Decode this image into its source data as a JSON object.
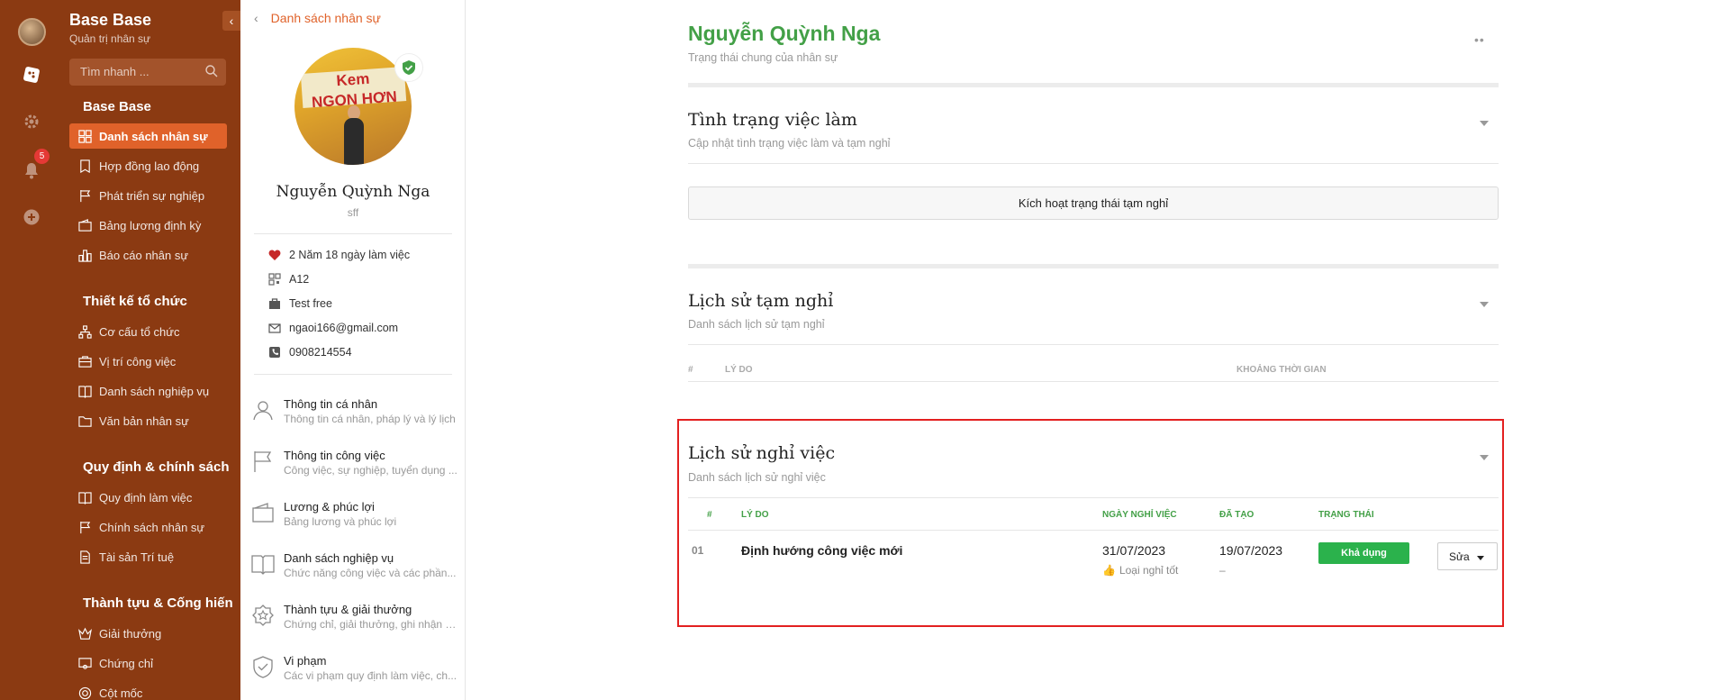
{
  "rail": {
    "notification_count": "5"
  },
  "sidebar": {
    "title": "Base Base",
    "subtitle": "Quản trị nhân sự",
    "search_placeholder": "Tìm nhanh ...",
    "groups": [
      {
        "label": "Base Base",
        "items": [
          {
            "label": "Danh sách nhân sự",
            "icon": "grid-icon",
            "active": true
          },
          {
            "label": "Hợp đồng lao động",
            "icon": "bookmark-icon"
          },
          {
            "label": "Phát triển sự nghiệp",
            "icon": "flag-icon"
          },
          {
            "label": "Bảng lương định kỳ",
            "icon": "wallet-icon"
          },
          {
            "label": "Báo cáo nhân sự",
            "icon": "bar-chart-icon"
          }
        ]
      },
      {
        "label": "Thiết kế tổ chức",
        "items": [
          {
            "label": "Cơ cấu tổ chức",
            "icon": "org-chart-icon"
          },
          {
            "label": "Vị trí công việc",
            "icon": "briefcase-icon"
          },
          {
            "label": "Danh sách nghiệp vụ",
            "icon": "book-icon"
          },
          {
            "label": "Văn bản nhân sự",
            "icon": "folder-icon"
          }
        ]
      },
      {
        "label": "Quy định & chính sách",
        "items": [
          {
            "label": "Quy định làm việc",
            "icon": "book-icon"
          },
          {
            "label": "Chính sách nhân sự",
            "icon": "flag-icon"
          },
          {
            "label": "Tài sản Trí tuệ",
            "icon": "document-icon"
          }
        ]
      },
      {
        "label": "Thành tựu & Cống hiến",
        "items": [
          {
            "label": "Giải thưởng",
            "icon": "crown-icon"
          },
          {
            "label": "Chứng chỉ",
            "icon": "certificate-icon"
          },
          {
            "label": "Cột mốc",
            "icon": "target-icon"
          }
        ]
      }
    ]
  },
  "profile": {
    "back_label": "Danh sách nhân sự",
    "photo_sign_line1": "Kem",
    "photo_sign_line2": "NGON HƠN",
    "name": "Nguyễn Quỳnh Nga",
    "code": "sff",
    "info": [
      {
        "icon": "heart-icon",
        "text": "2 Năm 18 ngày làm việc"
      },
      {
        "icon": "qr-code-icon",
        "text": "A12"
      },
      {
        "icon": "briefcase-icon",
        "text": "Test free"
      },
      {
        "icon": "mail-icon",
        "text": "ngaoi166@gmail.com"
      },
      {
        "icon": "phone-icon",
        "text": "0908214554"
      }
    ],
    "nav": [
      {
        "title": "Thông tin cá nhân",
        "desc": "Thông tin cá nhân, pháp lý và lý lịch",
        "icon": "user-icon"
      },
      {
        "title": "Thông tin công việc",
        "desc": "Công việc, sự nghiệp, tuyển dụng ...",
        "icon": "flag-icon"
      },
      {
        "title": "Lương & phúc lợi",
        "desc": "Bảng lương và phúc lợi",
        "icon": "wallet-icon"
      },
      {
        "title": "Danh sách nghiệp vụ",
        "desc": "Chức năng công việc và các phần...",
        "icon": "book-icon"
      },
      {
        "title": "Thành tựu & giải thưởng",
        "desc": "Chứng chỉ, giải thưởng, ghi nhận v...",
        "icon": "star-badge-icon"
      },
      {
        "title": "Vi phạm",
        "desc": "Các vi phạm quy định làm việc, ch...",
        "icon": "shield-check-icon"
      }
    ]
  },
  "main": {
    "title": "Nguyễn Quỳnh Nga",
    "subtitle": "Trạng thái chung của nhân sự",
    "employment": {
      "title": "Tình trạng việc làm",
      "subtitle": "Cập nhật tình trạng việc làm và tạm nghỉ",
      "button": "Kích hoạt trạng thái tạm nghỉ"
    },
    "leave_history": {
      "title": "Lịch sử tạm nghỉ",
      "subtitle": "Danh sách lịch sử tạm nghỉ",
      "columns": [
        "#",
        "LÝ DO",
        "KHOẢNG THỜI GIAN"
      ]
    },
    "resign_history": {
      "title": "Lịch sử nghỉ việc",
      "subtitle": "Danh sách lịch sử nghỉ việc",
      "columns": [
        "#",
        "LÝ DO",
        "NGÀY NGHỈ VIỆC",
        "ĐÃ TẠO",
        "TRẠNG THÁI"
      ],
      "rows": [
        {
          "index": "01",
          "reason": "Định hướng công việc mới",
          "date": "31/07/2023",
          "date_note": "Loại nghỉ tốt",
          "created": "19/07/2023",
          "created_note": "–",
          "status": "Khả dụng",
          "action": "Sửa"
        }
      ]
    }
  },
  "colors": {
    "sidebar_bg": "#8b3a12",
    "accent": "#e0622a",
    "title_green": "#43a047",
    "status_green": "#2bb24c",
    "highlight": "#e32020"
  }
}
